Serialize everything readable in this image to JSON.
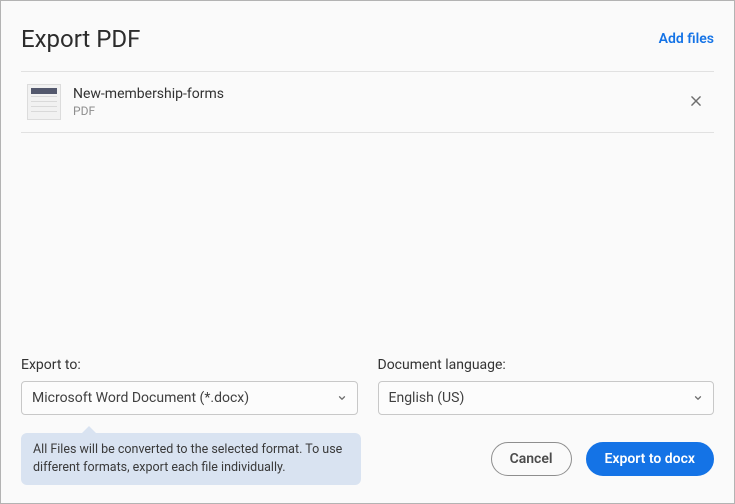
{
  "header": {
    "title": "Export PDF",
    "add_files": "Add files"
  },
  "files": [
    {
      "name": "New-membership-forms",
      "type": "PDF"
    }
  ],
  "config": {
    "export_to_label": "Export to:",
    "export_to_value": "Microsoft Word Document (*.docx)",
    "language_label": "Document language:",
    "language_value": "English (US)"
  },
  "tooltip": "All Files will be converted to the selected format. To use different formats, export each file individually.",
  "buttons": {
    "cancel": "Cancel",
    "export": "Export to docx"
  }
}
